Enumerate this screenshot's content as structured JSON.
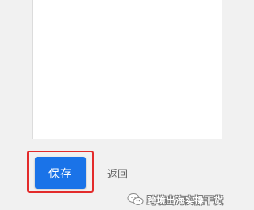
{
  "form": {
    "save_label": "保存",
    "back_label": "返回"
  },
  "watermark": {
    "text": "跨境出海实操干货",
    "icon": "wechat-icon"
  },
  "colors": {
    "primary_button": "#1a73e8",
    "highlight": "#e32b2b",
    "page_background": "#f1f1f1"
  }
}
